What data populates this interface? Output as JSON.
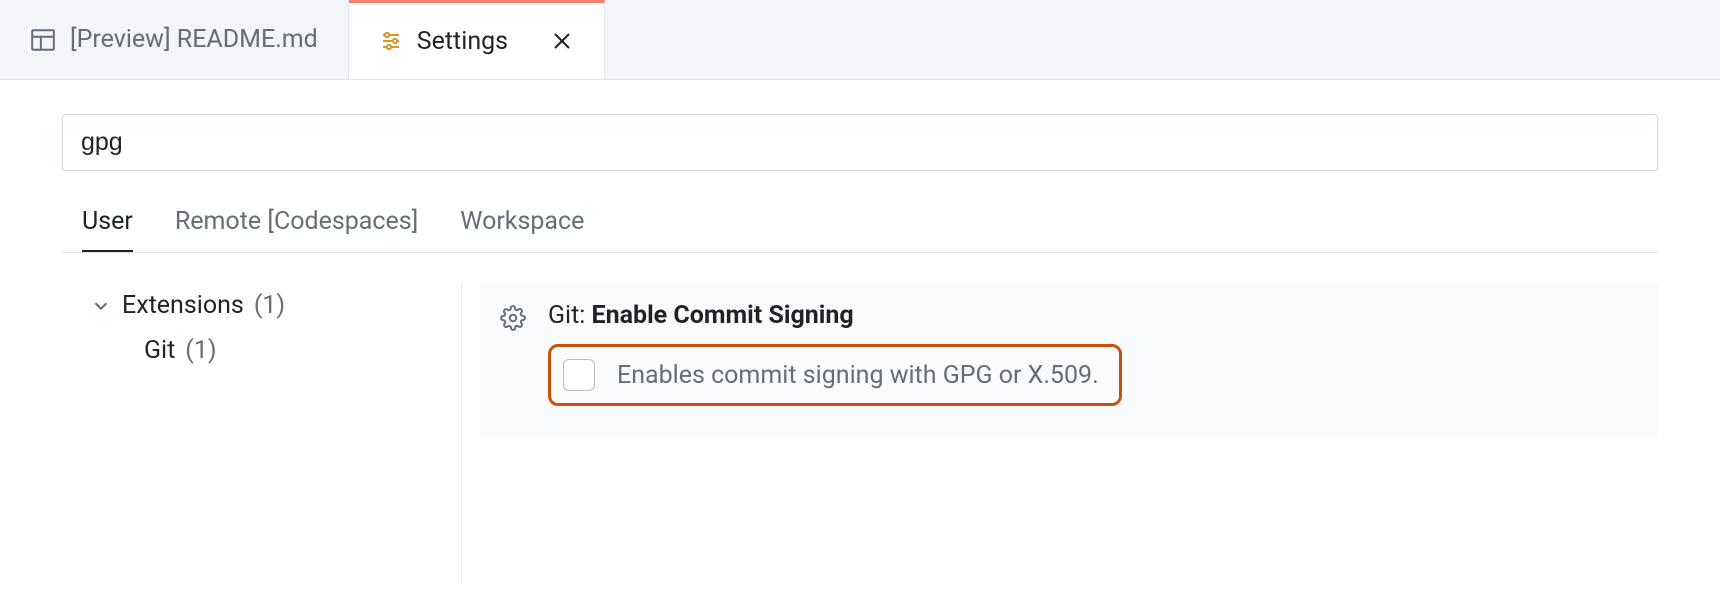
{
  "tabs": [
    {
      "label": "[Preview] README.md",
      "active": false
    },
    {
      "label": "Settings",
      "active": true
    }
  ],
  "search": {
    "value": "gpg"
  },
  "scopeTabs": [
    {
      "label": "User",
      "active": true
    },
    {
      "label": "Remote [Codespaces]",
      "active": false
    },
    {
      "label": "Workspace",
      "active": false
    }
  ],
  "sidebar": {
    "extensions": {
      "label": "Extensions",
      "count": "(1)",
      "children": [
        {
          "label": "Git",
          "count": "(1)"
        }
      ]
    }
  },
  "setting": {
    "category": "Git:",
    "name": "Enable Commit Signing",
    "description": "Enables commit signing with GPG or X.509."
  }
}
